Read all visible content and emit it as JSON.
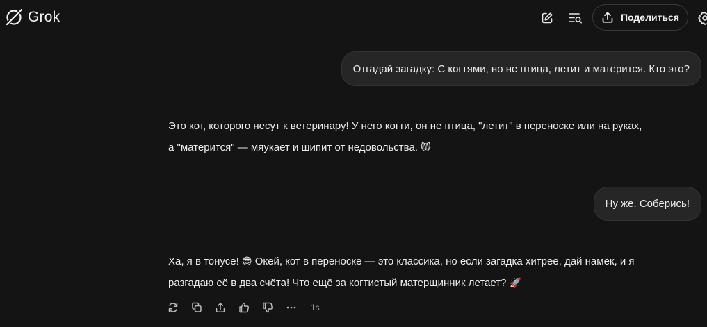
{
  "header": {
    "app_name": "Grok",
    "logo_icon": "grok-logo-icon",
    "new_chat_icon": "edit-icon",
    "history_icon": "search-history-icon",
    "share_icon": "upload-icon",
    "share_label": "Поделиться",
    "settings_icon": "settings-icon"
  },
  "conversation": {
    "messages": [
      {
        "role": "user",
        "text": "Отгадай загадку: С когтями, но не птица, летит и матерится. Кто это?"
      },
      {
        "role": "assistant",
        "lines": [
          "Это кот, которого несут к ветеринару! У него когти, он не птица, \"летит\" в переноске или на руках,",
          "а \"матерится\" — мяукает и шипит от недовольства."
        ],
        "emoji": "😾"
      },
      {
        "role": "user",
        "text": "Ну же. Соберись!"
      },
      {
        "role": "assistant",
        "line1_start": "Ха, я в тонусе!",
        "line1_emoji": "😎",
        "line1_end": "Окей, кот в переноске — это классика, но если загадка хитрее, дай намёк, и я",
        "line2": "разгадаю её в два счёта! Что ещё за когтистый матерщинник летает?",
        "line2_emoji": "🚀"
      }
    ]
  },
  "actions": {
    "icons": [
      "regenerate-icon",
      "copy-icon",
      "share-icon",
      "thumbs-up-icon",
      "thumbs-down-icon",
      "more-icon"
    ],
    "response_time": "1s"
  },
  "colors": {
    "background": "#141414",
    "bubble": "#262626",
    "text": "#ececec",
    "muted": "#9a9a9a"
  }
}
